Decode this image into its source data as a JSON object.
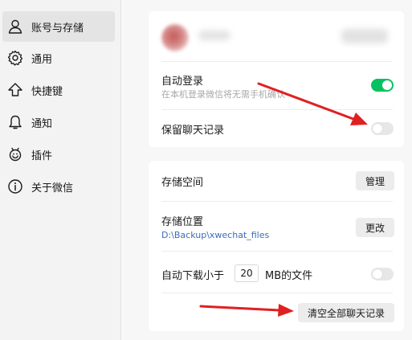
{
  "sidebar": {
    "items": [
      {
        "label": "账号与存储",
        "icon": "person-icon",
        "active": true
      },
      {
        "label": "通用",
        "icon": "gear-icon",
        "active": false
      },
      {
        "label": "快捷键",
        "icon": "upload-arrow-icon",
        "active": false
      },
      {
        "label": "通知",
        "icon": "bell-icon",
        "active": false
      },
      {
        "label": "插件",
        "icon": "plugin-icon",
        "active": false
      },
      {
        "label": "关于微信",
        "icon": "info-icon",
        "active": false
      }
    ]
  },
  "account_card": {
    "auto_login": {
      "label": "自动登录",
      "sub": "在本机登录微信将无需手机确认",
      "enabled": true
    },
    "keep_chat": {
      "label": "保留聊天记录",
      "enabled": false
    }
  },
  "storage_card": {
    "space": {
      "label": "存储空间",
      "button": "管理"
    },
    "location": {
      "label": "存储位置",
      "path": "D:\\Backup\\xwechat_files",
      "button": "更改"
    },
    "auto_download": {
      "prefix": "自动下载小于",
      "value": "20",
      "suffix": "MB的文件",
      "enabled": false
    },
    "clear_button": "清空全部聊天记录"
  },
  "colors": {
    "toggle_on": "#07c160",
    "arrow": "#e02020",
    "path_link": "#3d6bb8"
  }
}
